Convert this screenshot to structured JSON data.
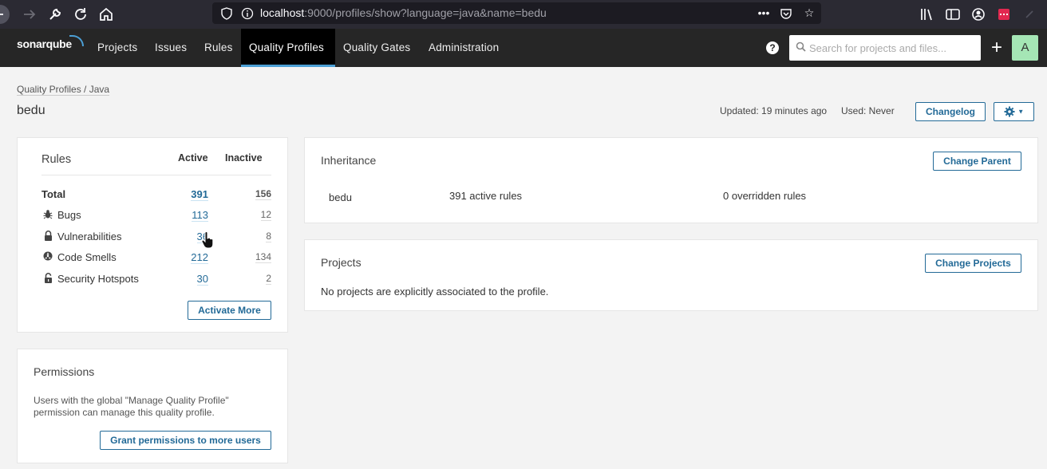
{
  "browser": {
    "url_host": "localhost",
    "url_rest": ":9000/profiles/show?language=java&name=bedu",
    "more_icon": "ellipsis-icon",
    "pocket_icon": "pocket-icon",
    "star_icon": "star-icon"
  },
  "nav": {
    "logo": "sonarqube",
    "items": [
      "Projects",
      "Issues",
      "Rules",
      "Quality Profiles",
      "Quality Gates",
      "Administration"
    ],
    "active_index": 3,
    "search_placeholder": "Search for projects and files...",
    "plus": "+",
    "avatar_letter": "A",
    "help": "?",
    "colors": {
      "bar": "#262626",
      "active": "#000000",
      "accent": "#4b9fd5",
      "avatar": "#a5e6b5"
    }
  },
  "header": {
    "breadcrumb": "Quality Profiles / Java",
    "title": "bedu",
    "updated": "Updated: 19 minutes ago",
    "used": "Used: Never",
    "changelog_label": "Changelog"
  },
  "rules": {
    "title": "Rules",
    "active_header": "Active",
    "inactive_header": "Inactive",
    "rows": [
      {
        "label": "Total",
        "icon": "",
        "active": "391",
        "inactive": "156"
      },
      {
        "label": "Bugs",
        "icon": "bug-icon",
        "active": "113",
        "inactive": "12"
      },
      {
        "label": "Vulnerabilities",
        "icon": "lock-icon",
        "active": "36",
        "inactive": "8"
      },
      {
        "label": "Code Smells",
        "icon": "code-smell-icon",
        "active": "212",
        "inactive": "134"
      },
      {
        "label": "Security Hotspots",
        "icon": "hotspot-icon",
        "active": "30",
        "inactive": "2"
      }
    ],
    "activate_more_label": "Activate More"
  },
  "permissions": {
    "title": "Permissions",
    "text_line1": "Users with the global \"Manage Quality Profile\"",
    "text_line2": "permission can manage this quality profile.",
    "grant_label": "Grant permissions to more users"
  },
  "inheritance": {
    "title": "Inheritance",
    "change_parent_label": "Change Parent",
    "profile_name": "bedu",
    "active_rules": "391 active rules",
    "overridden_rules": "0 overridden rules"
  },
  "projects": {
    "title": "Projects",
    "change_projects_label": "Change Projects",
    "empty_text": "No projects are explicitly associated to the profile."
  }
}
